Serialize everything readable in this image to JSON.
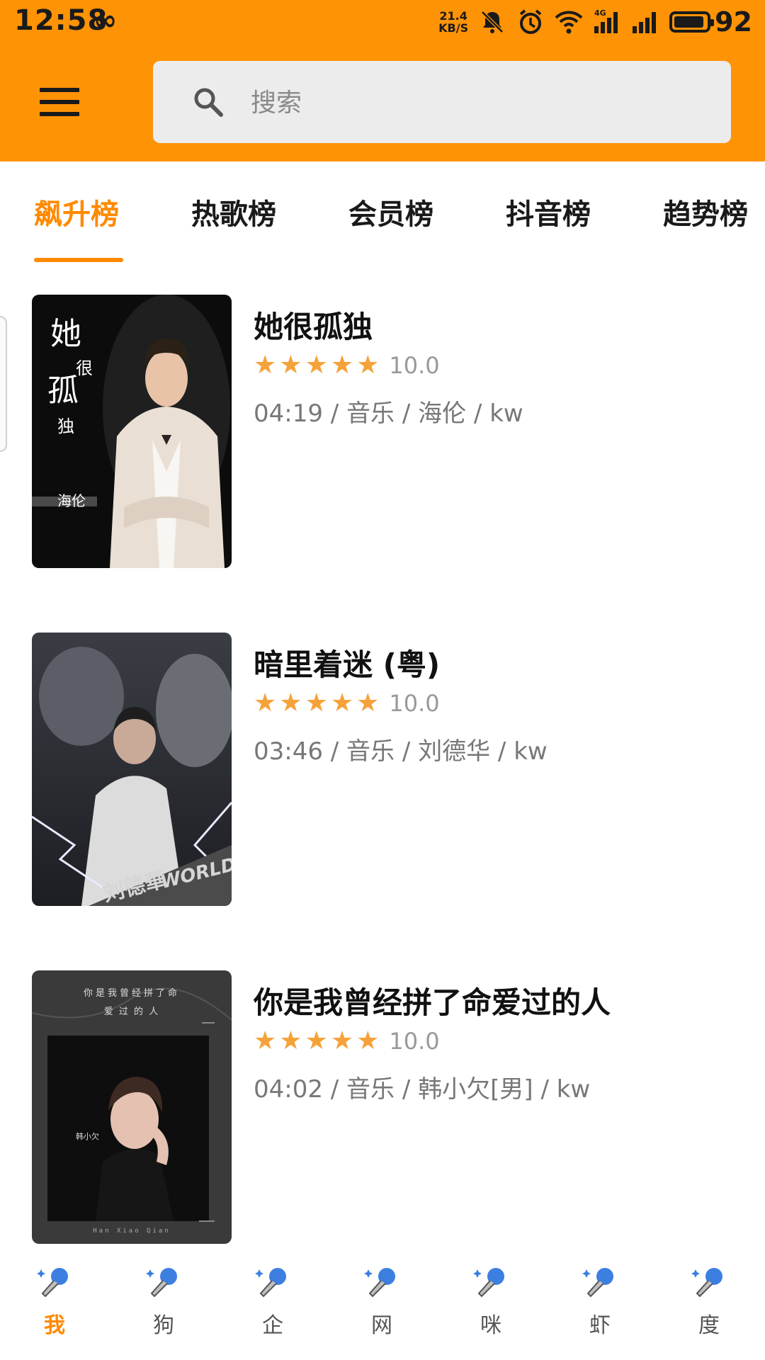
{
  "status_bar": {
    "time": "12:58",
    "loop_symbol": "∞",
    "net_speed_value": "21.4",
    "net_speed_unit": "KB/S",
    "network_label": "4G",
    "battery": "92",
    "battery_level": 0.92,
    "icons": [
      "mute-bell-icon",
      "alarm-icon",
      "wifi-icon",
      "signal-4g-icon",
      "signal-icon",
      "battery-icon"
    ]
  },
  "header": {
    "menu_icon": "hamburger-menu-icon",
    "search": {
      "placeholder": "搜索",
      "icon": "search-icon"
    },
    "background_color": "#ff9306"
  },
  "tabs": [
    {
      "label": "飙升榜",
      "active": true
    },
    {
      "label": "热歌榜",
      "active": false
    },
    {
      "label": "会员榜",
      "active": false
    },
    {
      "label": "抖音榜",
      "active": false
    },
    {
      "label": "趋势榜",
      "active": false
    }
  ],
  "songs": [
    {
      "title": "她很孤独",
      "rating": "10.0",
      "stars": 5,
      "meta": "04:19 / 音乐 / 海伦 / kw",
      "cover_text": [
        "她",
        "很",
        "孤",
        "独",
        "海伦"
      ]
    },
    {
      "title": "暗里着迷 (粤)",
      "rating": "10.0",
      "stars": 5,
      "meta": "03:46 / 音乐 / 刘德华 / kw",
      "cover_text": [
        "刘德華",
        "WORLD"
      ]
    },
    {
      "title": "你是我曾经拼了命爱过的人",
      "rating": "10.0",
      "stars": 5,
      "meta": "04:02 / 音乐 / 韩小欠[男] / kw",
      "cover_text": [
        "你是我曾经拼了命",
        "爱 过 的 人",
        "韩小欠",
        "Han Xiao Qian"
      ]
    }
  ],
  "bottom_nav": [
    {
      "label": "我",
      "icon": "microphone-icon",
      "active": true
    },
    {
      "label": "狗",
      "icon": "microphone-icon",
      "active": false
    },
    {
      "label": "企",
      "icon": "microphone-icon",
      "active": false
    },
    {
      "label": "网",
      "icon": "microphone-icon",
      "active": false
    },
    {
      "label": "咪",
      "icon": "microphone-icon",
      "active": false
    },
    {
      "label": "虾",
      "icon": "microphone-icon",
      "active": false
    },
    {
      "label": "度",
      "icon": "microphone-icon",
      "active": false
    }
  ],
  "colors": {
    "accent": "#ff8a00",
    "star": "#f6a23a"
  }
}
